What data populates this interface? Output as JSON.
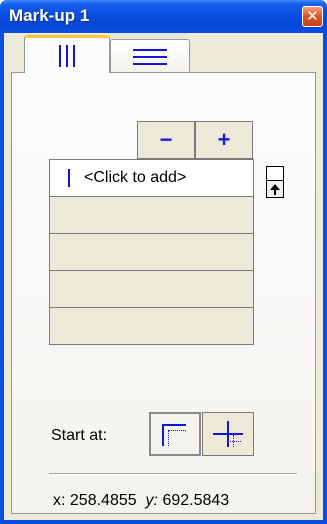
{
  "window": {
    "title": "Mark-up 1",
    "close_symbol": "✕"
  },
  "tabs": [
    {
      "name": "vertical",
      "icon": "vertical-lines-icon",
      "active": true
    },
    {
      "name": "horizontal",
      "icon": "horizontal-lines-icon",
      "active": false
    }
  ],
  "toolbar": {
    "minus_label": "−",
    "plus_label": "+"
  },
  "list": {
    "add_label": "<Click to add>",
    "empty_rows": 4
  },
  "start": {
    "label": "Start at:",
    "options": [
      "corner-origin-icon",
      "center-origin-icon"
    ],
    "selected": "corner-origin-icon"
  },
  "coords": {
    "x_label": "x:",
    "x_value": "258.4855",
    "y_label": "y:",
    "y_value": "692.5843"
  },
  "colors": {
    "titlebar": "#0a4fe2",
    "accent": "#1414d4",
    "face": "#ece9d8",
    "close": "#e05a2a"
  }
}
